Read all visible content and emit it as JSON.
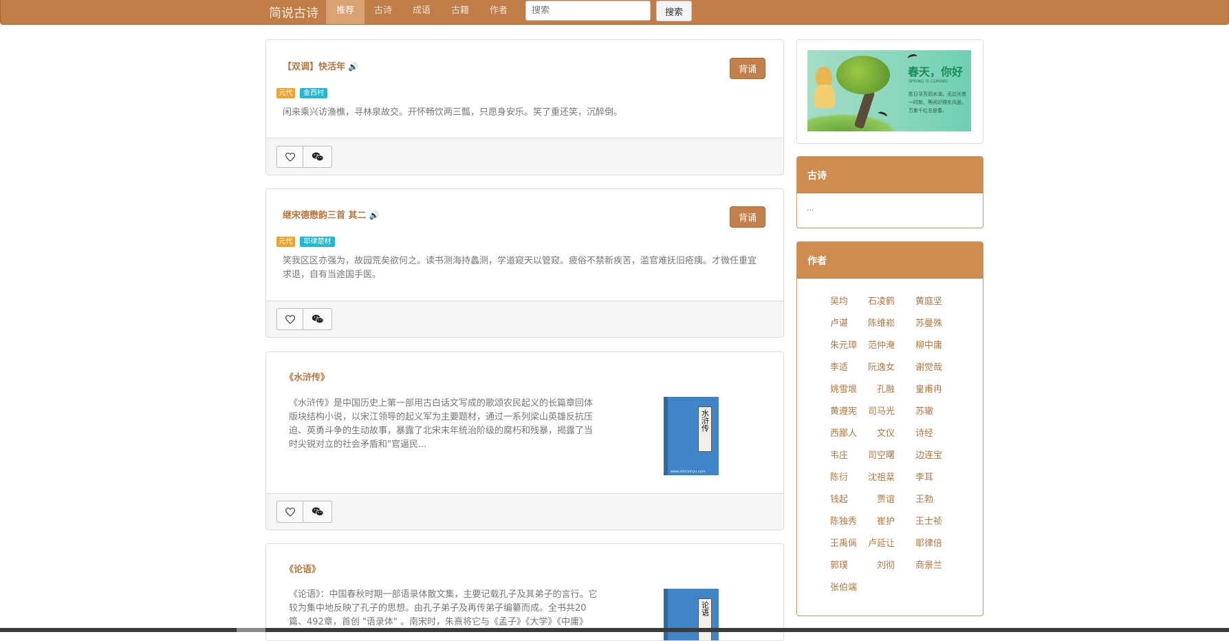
{
  "nav": {
    "brand": "简说古诗",
    "items": [
      {
        "label": "推荐",
        "active": true
      },
      {
        "label": "古诗",
        "active": false
      },
      {
        "label": "成语",
        "active": false
      },
      {
        "label": "古籍",
        "active": false
      },
      {
        "label": "作者",
        "active": false
      }
    ],
    "search_placeholder": "搜索",
    "search_button": "搜索"
  },
  "icons": {
    "speaker": "speaker-icon",
    "heart": "heart-icon",
    "wechat": "wechat-icon"
  },
  "colors": {
    "brand": "#c07d47",
    "accent": "#b5773f",
    "tag_era": "#f0a42e",
    "tag_author": "#23b7d0"
  },
  "poems": [
    {
      "title": "【双调】快活年",
      "recite_label": "背诵",
      "era": "元代",
      "author": "金西村",
      "text": "闲来乘兴访渔樵，寻林泉故交。开怀畅饮两三瓢，只愿身安乐。笑了重还笑，沉醉倒。"
    },
    {
      "title": "继宋德懋韵三首 其二",
      "recite_label": "背诵",
      "era": "元代",
      "author": "耶律楚材",
      "text": "笑我区区亦强为，故园荒矣欲何之。读书测海持蠡测，学道窥天以管窥。疲俗不禁新疾苦，滥官难抚旧疮痍。才微任重宜求退，自有当途国手医。"
    }
  ],
  "books": [
    {
      "title": "《水浒传》",
      "cover_title": "水浒传",
      "cover_url": "www.shicixinyu.com",
      "text": "《水浒传》是中国历史上第一部用古白话文写成的歌颂农民起义的长篇章回体版块结构小说，以宋江领导的起义军为主要题材，通过一系列梁山英雄反抗压迫、英勇斗争的生动故事，暴露了北宋末年统治阶级的腐朽和残暴，揭露了当时尖锐对立的社会矛盾和\"官逼民..."
    },
    {
      "title": "《论语》",
      "cover_title": "论语",
      "text": "《论语》：中国春秋时期一部语录体散文集，主要记载孔子及其弟子的言行。它较为集中地反映了孔子的思想。由孔子弟子及再传弟子编纂而成。全书共20篇、492章，首创 \"语录体\" 。南宋时，朱熹将它与《孟子》《大学》《中庸》"
    }
  ],
  "sidebar": {
    "banner": {
      "main": "春天，你好",
      "sub": "SPRING IS COMING",
      "verse": "胜日寻芳泗水滨，无边光景一时新。等闲识得东风面，万紫千红总是春。"
    },
    "poems_box": {
      "title": "古诗",
      "content": "..."
    },
    "authors_box": {
      "title": "作者",
      "rows": [
        [
          "吴均",
          "石凌鹤",
          "黄庭坚"
        ],
        [
          "卢谌",
          "陈维崧",
          "苏曼殊"
        ],
        [
          "朱元璋",
          "范仲淹",
          "柳中庸"
        ],
        [
          "李适",
          "阮逸女",
          "谢觉哉"
        ],
        [
          "姚雪垠",
          "孔融",
          "皇甫冉"
        ],
        [
          "黄遵宪",
          "司马光",
          "苏辙"
        ],
        [
          "西鄙人",
          "文仪",
          "诗经"
        ],
        [
          "韦庄",
          "司空曙",
          "边连宝"
        ],
        [
          "陈衍",
          "沈祖棻",
          "李耳"
        ],
        [
          "钱起",
          "贾谊",
          "王勃"
        ],
        [
          "陈独秀",
          "崔护",
          "王士祯"
        ],
        [
          "王禹偁",
          "卢延让",
          "耶律倍"
        ],
        [
          "郭璞",
          "刘彻",
          "商景兰"
        ],
        [
          "张伯端"
        ]
      ]
    }
  }
}
